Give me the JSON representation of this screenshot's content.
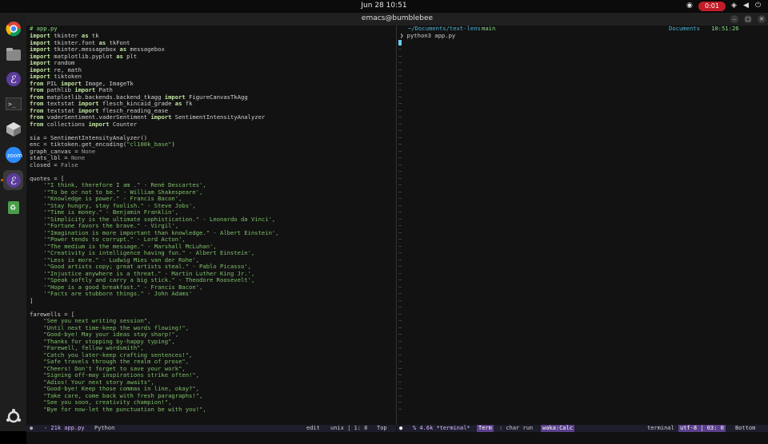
{
  "topbar": {
    "clock": "Jun 28  10:51",
    "record_label": "0:01"
  },
  "window": {
    "title": "emacs@bumblebee"
  },
  "left_pane": {
    "tab": "# app.py",
    "code_lines": [
      [
        [
          "kw",
          "import"
        ],
        [
          "id",
          " tkinter "
        ],
        [
          "kw",
          "as"
        ],
        [
          "id",
          " tk"
        ]
      ],
      [
        [
          "kw",
          "import"
        ],
        [
          "id",
          " tkinter.font "
        ],
        [
          "kw",
          "as"
        ],
        [
          "id",
          " tkFont"
        ]
      ],
      [
        [
          "kw",
          "import"
        ],
        [
          "id",
          " tkinter.messagebox "
        ],
        [
          "kw",
          "as"
        ],
        [
          "id",
          " messagebox"
        ]
      ],
      [
        [
          "kw",
          "import"
        ],
        [
          "id",
          " matplotlib.pyplot "
        ],
        [
          "kw",
          "as"
        ],
        [
          "id",
          " plt"
        ]
      ],
      [
        [
          "kw",
          "import"
        ],
        [
          "id",
          " random"
        ]
      ],
      [
        [
          "kw",
          "import"
        ],
        [
          "id",
          " re, math"
        ]
      ],
      [
        [
          "kw",
          "import"
        ],
        [
          "id",
          " tiktoken"
        ]
      ],
      [
        [
          "kw",
          "from"
        ],
        [
          "id",
          " PIL "
        ],
        [
          "kw",
          "import"
        ],
        [
          "id",
          " Image, ImageTk"
        ]
      ],
      [
        [
          "kw",
          "from"
        ],
        [
          "id",
          " pathlib "
        ],
        [
          "kw",
          "import"
        ],
        [
          "id",
          " Path"
        ]
      ],
      [
        [
          "kw",
          "from"
        ],
        [
          "id",
          " matplotlib.backends.backend_tkagg "
        ],
        [
          "kw",
          "import"
        ],
        [
          "id",
          " FigureCanvasTkAgg"
        ]
      ],
      [
        [
          "kw",
          "from"
        ],
        [
          "id",
          " textstat "
        ],
        [
          "kw",
          "import"
        ],
        [
          "id",
          " flesch_kincaid_grade "
        ],
        [
          "kw",
          "as"
        ],
        [
          "id",
          " fk"
        ]
      ],
      [
        [
          "kw",
          "from"
        ],
        [
          "id",
          " textstat "
        ],
        [
          "kw",
          "import"
        ],
        [
          "id",
          " flesch_reading_ease"
        ]
      ],
      [
        [
          "kw",
          "from"
        ],
        [
          "id",
          " vaderSentiment.vaderSentiment "
        ],
        [
          "kw",
          "import"
        ],
        [
          "id",
          " SentimentIntensityAnalyzer"
        ]
      ],
      [
        [
          "kw",
          "from"
        ],
        [
          "id",
          " collections "
        ],
        [
          "kw",
          "import"
        ],
        [
          "id",
          " Counter"
        ]
      ],
      [],
      [
        [
          "id",
          "sia = SentimentIntensityAnalyzer()"
        ]
      ],
      [
        [
          "id",
          "enc = tiktoken.get_encoding("
        ],
        [
          "str",
          "\"cl100k_base\""
        ],
        [
          "id",
          ")"
        ]
      ],
      [
        [
          "id",
          "graph_canvas = "
        ],
        [
          "const",
          "None"
        ]
      ],
      [
        [
          "id",
          "stats_lbl = "
        ],
        [
          "const",
          "None"
        ]
      ],
      [
        [
          "id",
          "closed = "
        ],
        [
          "const",
          "False"
        ]
      ],
      [],
      [
        [
          "id",
          "quotes = ["
        ]
      ],
      [
        [
          "str",
          "    '\"I think, therefore I am .\" - René Descartes',"
        ]
      ],
      [
        [
          "str",
          "    '\"To be or not to be.\" - William Shakespeare',"
        ]
      ],
      [
        [
          "str",
          "    '\"Knowledge is power.\" - Francis Bacon',"
        ]
      ],
      [
        [
          "str",
          "    '\"Stay hungry, stay foolish.\" - Steve Jobs',"
        ]
      ],
      [
        [
          "str",
          "    '\"Time is money.\" - Benjamin Franklin',"
        ]
      ],
      [
        [
          "str",
          "    '\"Simplicity is the ultimate sophistication.\" - Leonardo da Vinci',"
        ]
      ],
      [
        [
          "str",
          "    '\"Fortune favors the brave.\" - Virgil',"
        ]
      ],
      [
        [
          "str",
          "    '\"Imagination is more important than knowledge.\" - Albert Einstein',"
        ]
      ],
      [
        [
          "str",
          "    '\"Power tends to corrupt.\" - Lord Acton',"
        ]
      ],
      [
        [
          "str",
          "    '\"The medium is the message.\" - Marshall McLuhan',"
        ]
      ],
      [
        [
          "str",
          "    '\"Creativity is intelligence having fun.\" - Albert Einstein',"
        ]
      ],
      [
        [
          "str",
          "    '\"Less is more.\" - Ludwig Mies van der Rohe',"
        ]
      ],
      [
        [
          "str",
          "    '\"Good artists copy; great artists steal.\" - Pablo Picasso',"
        ]
      ],
      [
        [
          "str",
          "    '\"Injustice anywhere is a threat.\" - Martin Luther King Jr.',"
        ]
      ],
      [
        [
          "str",
          "    '\"Speak softly and carry a big stick.\" - Theodore Roosevelt',"
        ]
      ],
      [
        [
          "str",
          "    '\"Hope is a good breakfast.\" - Francis Bacon',"
        ]
      ],
      [
        [
          "str",
          "    '\"Facts are stubborn things.\" - John Adams'"
        ]
      ],
      [
        [
          "id",
          "]"
        ]
      ],
      [],
      [
        [
          "id",
          "farewells = ["
        ]
      ],
      [
        [
          "str",
          "    \"See you next writing session\","
        ]
      ],
      [
        [
          "str",
          "    \"Until next time-keep the words flowing!\","
        ]
      ],
      [
        [
          "str",
          "    \"Good-bye! May your ideas stay sharp!\","
        ]
      ],
      [
        [
          "str",
          "    \"Thanks for stopping by-happy typing\","
        ]
      ],
      [
        [
          "str",
          "    \"Farewell, fellow wordsmith\","
        ]
      ],
      [
        [
          "str",
          "    \"Catch you later-keep crafting sentences!\","
        ]
      ],
      [
        [
          "str",
          "    \"Safe travels through the realm of prose\","
        ]
      ],
      [
        [
          "str",
          "    \"Cheers! Don't forget to save your work\","
        ]
      ],
      [
        [
          "str",
          "    \"Signing off-may inspirations strike often!\","
        ]
      ],
      [
        [
          "str",
          "    \"Adios! Your next story awaits\","
        ]
      ],
      [
        [
          "str",
          "    \"Good-bye! Keep those commas in line, okay?\","
        ]
      ],
      [
        [
          "str",
          "    \"Take care, come back with fresh paragraphs!\","
        ]
      ],
      [
        [
          "str",
          "    \"See you soon, creativity champion!\","
        ]
      ],
      [
        [
          "str",
          "    \"Bye for now-let the punctuation be with you!\","
        ]
      ]
    ]
  },
  "right_pane": {
    "path": "~/Documents/text-lens",
    "branch": "main",
    "dir_label": "Documents",
    "time": "10:51:26",
    "prompt": "python3 app.py"
  },
  "modeline_left": {
    "size_file": "- 21k app.py",
    "mode": "Python",
    "state": "edit",
    "encoding": "unix | 1: 8",
    "position": "Top"
  },
  "modeline_right": {
    "buffer": "% 4.6k *terminal*",
    "term": "Term",
    "run": ": char run",
    "waka": "waka:Calc",
    "mode": "terminal",
    "encoding": "utf-8 | 03: 0",
    "position": "Bottom"
  },
  "colors": {
    "accent": "#4bb4d8",
    "keyword": "#bfe3a0",
    "string": "#7fbf6a",
    "badge": "#5a3f8a"
  }
}
